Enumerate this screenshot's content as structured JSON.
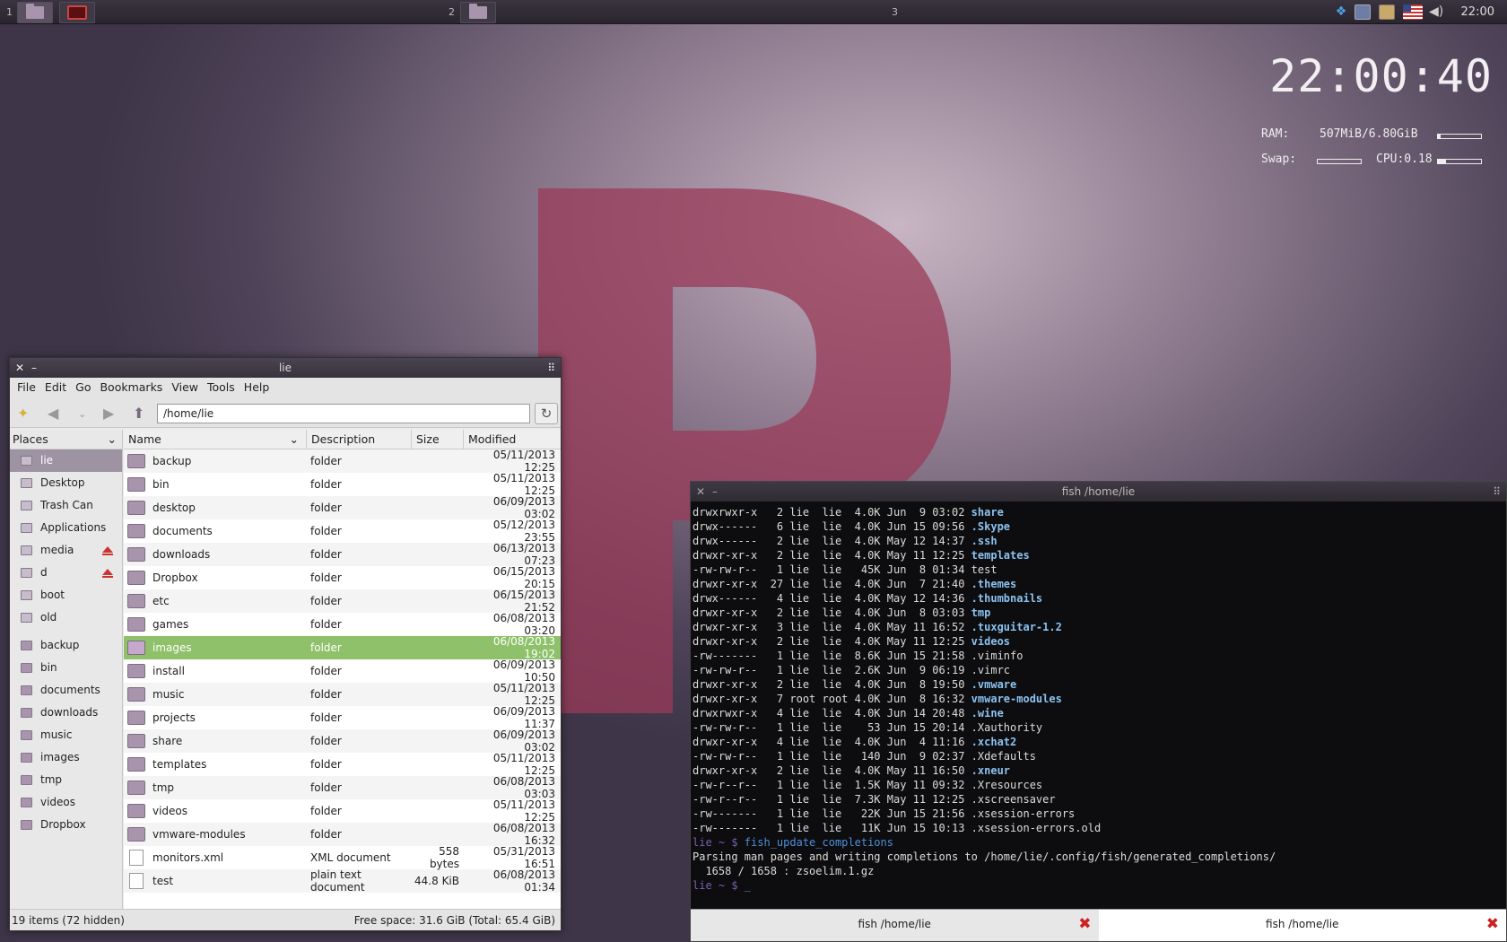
{
  "panel": {
    "workspace_1": "1",
    "workspace_2": "2",
    "workspace_3": "3",
    "clock": "22:00",
    "tray_icons": [
      "dropbox-icon",
      "network-icon",
      "clipboard-icon",
      "us-flag-icon",
      "volume-icon"
    ]
  },
  "conky": {
    "time": "22:00:40",
    "ram_label": "RAM:",
    "ram_value": "507MiB/6.80GiB",
    "ram_usage": 0.07,
    "swap_label": "Swap:",
    "swap_usage": 0,
    "cpu_label": "CPU:0.18",
    "cpu_usage": 0.18
  },
  "filemanager": {
    "title": "lie",
    "menu": [
      "File",
      "Edit",
      "Go",
      "Bookmarks",
      "View",
      "Tools",
      "Help"
    ],
    "address": "/home/lie",
    "places_header": "Places",
    "places": [
      {
        "label": "lie",
        "selected": true
      },
      {
        "label": "Desktop"
      },
      {
        "label": "Trash Can"
      },
      {
        "label": "Applications"
      },
      {
        "label": "media",
        "eject": true
      },
      {
        "label": "d",
        "eject": true
      },
      {
        "label": "boot"
      },
      {
        "label": "old"
      }
    ],
    "bookmarks": [
      "backup",
      "bin",
      "documents",
      "downloads",
      "music",
      "images",
      "tmp",
      "videos",
      "Dropbox"
    ],
    "columns": {
      "name": "Name",
      "description": "Description",
      "size": "Size",
      "modified": "Modified"
    },
    "files": [
      {
        "name": "backup",
        "desc": "folder",
        "size": "",
        "modified": "05/11/2013 12:25"
      },
      {
        "name": "bin",
        "desc": "folder",
        "size": "",
        "modified": "05/11/2013 12:25"
      },
      {
        "name": "desktop",
        "desc": "folder",
        "size": "",
        "modified": "06/09/2013 03:02"
      },
      {
        "name": "documents",
        "desc": "folder",
        "size": "",
        "modified": "05/12/2013 23:55"
      },
      {
        "name": "downloads",
        "desc": "folder",
        "size": "",
        "modified": "06/13/2013 07:23"
      },
      {
        "name": "Dropbox",
        "desc": "folder",
        "size": "",
        "modified": "06/15/2013 20:15"
      },
      {
        "name": "etc",
        "desc": "folder",
        "size": "",
        "modified": "06/15/2013 21:52"
      },
      {
        "name": "games",
        "desc": "folder",
        "size": "",
        "modified": "06/08/2013 03:20"
      },
      {
        "name": "images",
        "desc": "folder",
        "size": "",
        "modified": "06/08/2013 19:02",
        "selected": true
      },
      {
        "name": "install",
        "desc": "folder",
        "size": "",
        "modified": "06/09/2013 10:50"
      },
      {
        "name": "music",
        "desc": "folder",
        "size": "",
        "modified": "05/11/2013 12:25"
      },
      {
        "name": "projects",
        "desc": "folder",
        "size": "",
        "modified": "06/09/2013 11:37"
      },
      {
        "name": "share",
        "desc": "folder",
        "size": "",
        "modified": "06/09/2013 03:02"
      },
      {
        "name": "templates",
        "desc": "folder",
        "size": "",
        "modified": "05/11/2013 12:25"
      },
      {
        "name": "tmp",
        "desc": "folder",
        "size": "",
        "modified": "06/08/2013 03:03"
      },
      {
        "name": "videos",
        "desc": "folder",
        "size": "",
        "modified": "05/11/2013 12:25"
      },
      {
        "name": "vmware-modules",
        "desc": "folder",
        "size": "",
        "modified": "06/08/2013 16:32"
      },
      {
        "name": "monitors.xml",
        "desc": "XML document",
        "size": "558 bytes",
        "modified": "05/31/2013 16:51",
        "type": "doc"
      },
      {
        "name": "test",
        "desc": "plain text document",
        "size": "44.8 KiB",
        "modified": "06/08/2013 01:34",
        "type": "doc"
      }
    ],
    "status_left": "19 items (72 hidden)",
    "status_right": "Free space: 31.6 GiB (Total: 65.4 GiB)"
  },
  "terminal": {
    "title": "fish  /home/lie",
    "lines": [
      {
        "meta": "drwxrwxr-x   2 lie  lie  4.0K Jun  9 03:02 ",
        "name": "share",
        "dir": true
      },
      {
        "meta": "drwx------   6 lie  lie  4.0K Jun 15 09:56 ",
        "name": ".Skype",
        "dir": true
      },
      {
        "meta": "drwx------   2 lie  lie  4.0K May 12 14:37 ",
        "name": ".ssh",
        "dir": true
      },
      {
        "meta": "drwxr-xr-x   2 lie  lie  4.0K May 11 12:25 ",
        "name": "templates",
        "dir": true
      },
      {
        "meta": "-rw-rw-r--   1 lie  lie   45K Jun  8 01:34 ",
        "name": "test",
        "dir": false
      },
      {
        "meta": "drwxr-xr-x  27 lie  lie  4.0K Jun  7 21:40 ",
        "name": ".themes",
        "dir": true
      },
      {
        "meta": "drwx------   4 lie  lie  4.0K May 12 14:36 ",
        "name": ".thumbnails",
        "dir": true
      },
      {
        "meta": "drwxr-xr-x   2 lie  lie  4.0K Jun  8 03:03 ",
        "name": "tmp",
        "dir": true
      },
      {
        "meta": "drwxr-xr-x   3 lie  lie  4.0K May 11 16:52 ",
        "name": ".tuxguitar-1.2",
        "dir": true
      },
      {
        "meta": "drwxr-xr-x   2 lie  lie  4.0K May 11 12:25 ",
        "name": "videos",
        "dir": true
      },
      {
        "meta": "-rw-------   1 lie  lie  8.6K Jun 15 21:58 ",
        "name": ".viminfo",
        "dir": false
      },
      {
        "meta": "-rw-rw-r--   1 lie  lie  2.6K Jun  9 06:19 ",
        "name": ".vimrc",
        "dir": false
      },
      {
        "meta": "drwxr-xr-x   2 lie  lie  4.0K Jun  8 19:50 ",
        "name": ".vmware",
        "dir": true
      },
      {
        "meta": "drwxr-xr-x   7 root root 4.0K Jun  8 16:32 ",
        "name": "vmware-modules",
        "dir": true
      },
      {
        "meta": "drwxrwxr-x   4 lie  lie  4.0K Jun 14 20:48 ",
        "name": ".wine",
        "dir": true
      },
      {
        "meta": "-rw-rw-r--   1 lie  lie    53 Jun 15 20:14 ",
        "name": ".Xauthority",
        "dir": false
      },
      {
        "meta": "drwxr-xr-x   4 lie  lie  4.0K Jun  4 11:16 ",
        "name": ".xchat2",
        "dir": true
      },
      {
        "meta": "-rw-rw-r--   1 lie  lie   140 Jun  9 02:37 ",
        "name": ".Xdefaults",
        "dir": false
      },
      {
        "meta": "drwxr-xr-x   2 lie  lie  4.0K May 11 16:50 ",
        "name": ".xneur",
        "dir": true
      },
      {
        "meta": "-rw-r--r--   1 lie  lie  1.5K May 11 09:32 ",
        "name": ".Xresources",
        "dir": false
      },
      {
        "meta": "-rw-r--r--   1 lie  lie  7.3K May 11 12:25 ",
        "name": ".xscreensaver",
        "dir": false
      },
      {
        "meta": "-rw-------   1 lie  lie   22K Jun 15 21:56 ",
        "name": ".xsession-errors",
        "dir": false
      },
      {
        "meta": "-rw-------   1 lie  lie   11K Jun 15 10:13 ",
        "name": ".xsession-errors.old",
        "dir": false
      }
    ],
    "prompt": "lie ~ $ ",
    "command": "fish_update_completions",
    "output_1": "Parsing man pages and writing completions to /home/lie/.config/fish/generated_completions/",
    "output_2": "  1658 / 1658 : zsoelim.1.gz",
    "cursor": "_",
    "tabs": [
      {
        "label": "fish  /home/lie",
        "active": false
      },
      {
        "label": "fish  /home/lie",
        "active": true
      }
    ]
  }
}
